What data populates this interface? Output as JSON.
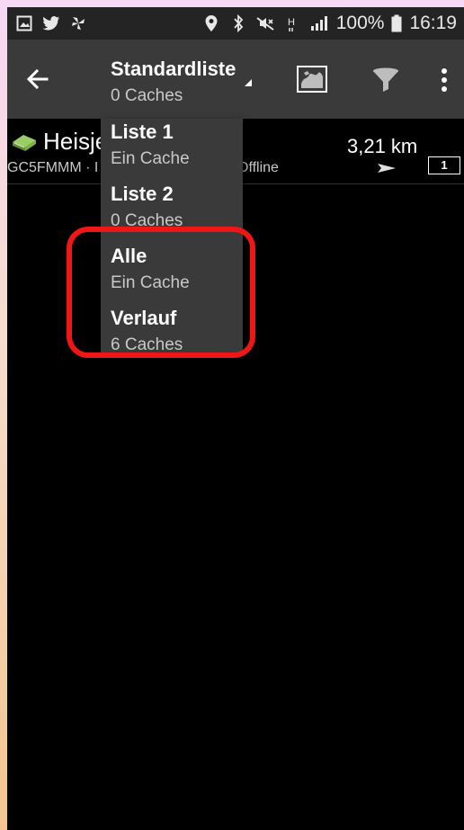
{
  "status_bar": {
    "left_icons": [
      "gallery-icon",
      "twitter-icon",
      "pinwheel-icon"
    ],
    "right_icons": [
      "location-icon",
      "bluetooth-icon",
      "mute-icon",
      "h-plus-icon",
      "signal-icon"
    ],
    "battery": "100%",
    "time": "16:19"
  },
  "action_bar": {
    "title": "Standardliste",
    "subtitle": "0 Caches"
  },
  "cache": {
    "name": "Heisje",
    "code": "GC5FMMM · I",
    "status": "Offline",
    "distance": "3,21 km",
    "count": "1"
  },
  "dropdown": {
    "items": [
      {
        "label": "Liste 1",
        "count": "Ein Cache"
      },
      {
        "label": "Liste 2",
        "count": "0 Caches"
      },
      {
        "label": "Alle",
        "count": "Ein Cache"
      },
      {
        "label": "Verlauf",
        "count": "6 Caches"
      }
    ]
  },
  "colors": {
    "highlight": "#ef1616",
    "action_bar": "#3a3a3a",
    "status_bar": "#242424",
    "cache_icon": "#5cb85c"
  }
}
